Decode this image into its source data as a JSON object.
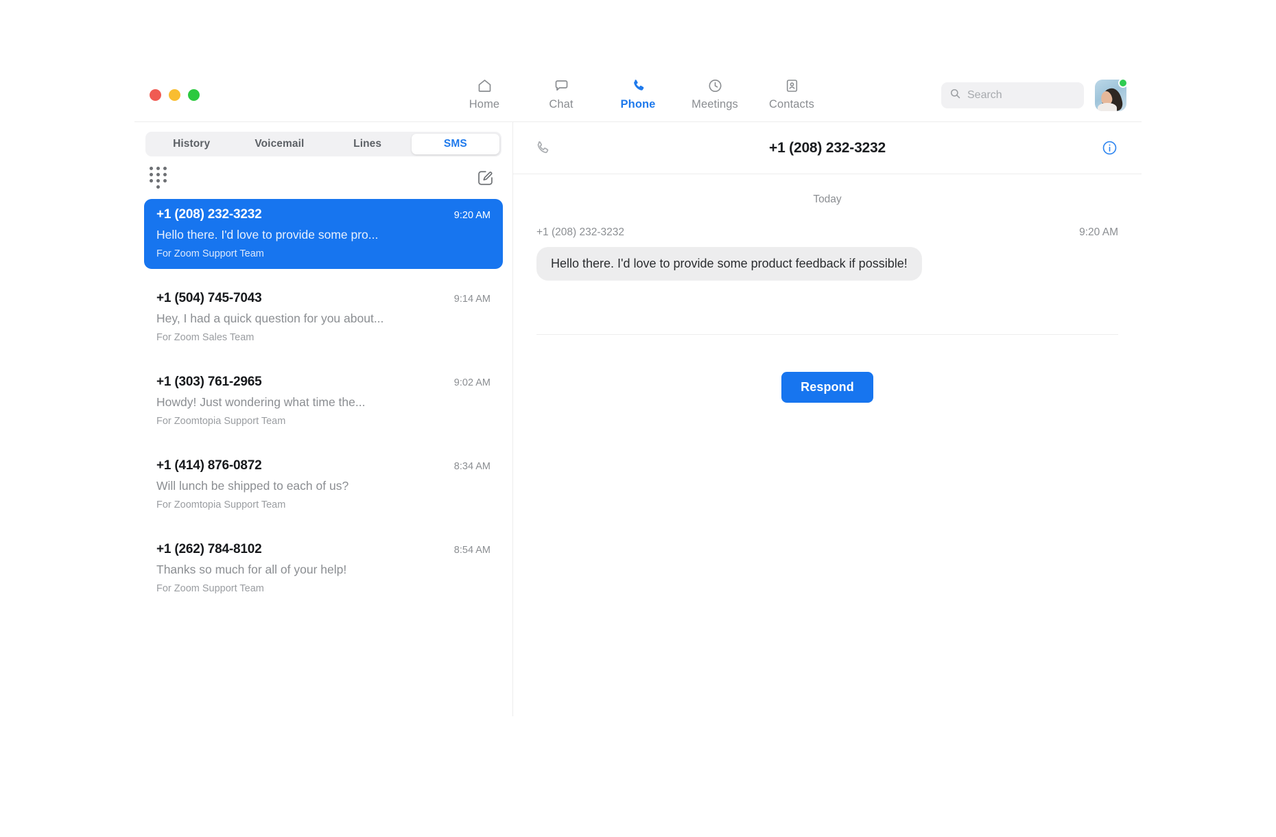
{
  "window": {
    "traffic_lights": [
      {
        "name": "close",
        "color": "#f05b52"
      },
      {
        "name": "minimize",
        "color": "#f9bd30"
      },
      {
        "name": "maximize",
        "color": "#2cc93f"
      }
    ]
  },
  "nav": {
    "items": [
      {
        "label": "Home",
        "icon": "home-icon",
        "active": false
      },
      {
        "label": "Chat",
        "icon": "chat-bubble-icon",
        "active": false
      },
      {
        "label": "Phone",
        "icon": "phone-icon",
        "active": true
      },
      {
        "label": "Meetings",
        "icon": "clock-icon",
        "active": false
      },
      {
        "label": "Contacts",
        "icon": "contact-card-icon",
        "active": false
      }
    ],
    "active_color": "#1f7aec",
    "inactive_color": "#8a8d91"
  },
  "search": {
    "placeholder": "Search",
    "value": "",
    "icon": "search-icon"
  },
  "account": {
    "avatar_alt": "user-avatar",
    "status": "available",
    "status_color": "#2fcc52"
  },
  "left_pane": {
    "tabs": [
      {
        "label": "History",
        "active": false
      },
      {
        "label": "Voicemail",
        "active": false
      },
      {
        "label": "Lines",
        "active": false
      },
      {
        "label": "SMS",
        "active": true
      }
    ],
    "toolbar": {
      "dialpad_icon": "dialpad-icon",
      "compose_icon": "compose-message-icon"
    },
    "conversations": [
      {
        "number": "+1 (208) 232-3232",
        "time": "9:20 AM",
        "preview": "Hello there. I'd love to provide some pro...",
        "for_line": "For Zoom Support Team",
        "selected": true
      },
      {
        "number": "+1 (504) 745-7043",
        "time": "9:14 AM",
        "preview": "Hey, I had a quick question for you about...",
        "for_line": "For Zoom Sales Team",
        "selected": false
      },
      {
        "number": "+1 (303) 761-2965",
        "time": "9:02 AM",
        "preview": "Howdy! Just wondering what time the...",
        "for_line": "For Zoomtopia Support Team",
        "selected": false
      },
      {
        "number": "+1 (414) 876-0872",
        "time": "8:34 AM",
        "preview": "Will lunch be shipped to each of us?",
        "for_line": "For Zoomtopia Support Team",
        "selected": false
      },
      {
        "number": "+1 (262) 784-8102",
        "time": "8:54 AM",
        "preview": "Thanks so much for all of your help!",
        "for_line": "For Zoom Support Team",
        "selected": false
      }
    ]
  },
  "thread": {
    "call_icon": "phone-handset-icon",
    "title": "+1 (208) 232-3232",
    "info_icon": "info-circle-icon",
    "day_separator": "Today",
    "messages": [
      {
        "sender": "+1 (208) 232-3232",
        "time": "9:20 AM",
        "text": "Hello there. I'd love to provide some product feedback if possible!",
        "direction": "incoming"
      }
    ],
    "respond_label": "Respond"
  },
  "theme": {
    "accent": "#1775ef",
    "nav_accent": "#1f7aec",
    "bubble_bg": "#ededee",
    "muted_text": "#8b8e92"
  }
}
